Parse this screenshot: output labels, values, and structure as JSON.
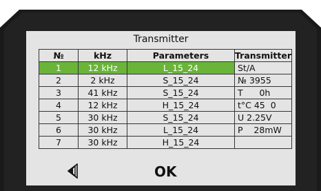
{
  "screen": {
    "title": "Transmitter",
    "ok_label": "OK"
  },
  "icons": {
    "back": "back-arrow-icon"
  },
  "colors": {
    "selected_row": "#6ab43a",
    "bezel": "#1a1a1a",
    "screen_bg": "#e4e4e4"
  },
  "table": {
    "headers": [
      "№",
      "kHz",
      "Parameters",
      "Transmitter"
    ],
    "rows": [
      {
        "num": "1",
        "khz": "12 kHz",
        "param": "L_15_24",
        "info": "St/A",
        "selected": true
      },
      {
        "num": "2",
        "khz": "2 kHz",
        "param": "S_15_24",
        "info": "№ 3955"
      },
      {
        "num": "3",
        "khz": "41 kHz",
        "param": "S_15_24",
        "info": "T      0h"
      },
      {
        "num": "4",
        "khz": "12 kHz",
        "param": "H_15_24",
        "info": "t°C 45  0"
      },
      {
        "num": "5",
        "khz": "30 kHz",
        "param": "S_15_24",
        "info": "U 2.25V"
      },
      {
        "num": "6",
        "khz": "30 kHz",
        "param": "L_15_24",
        "info": "P    28mW"
      },
      {
        "num": "7",
        "khz": "30 kHz",
        "param": "H_15_24",
        "info": ""
      }
    ]
  }
}
